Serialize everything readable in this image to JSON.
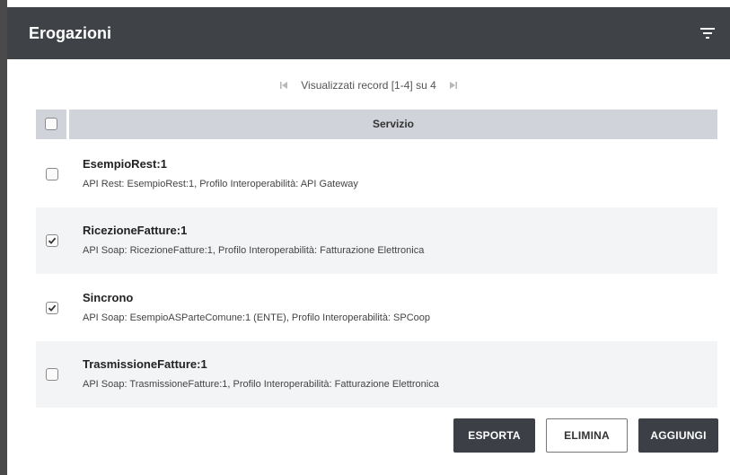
{
  "header": {
    "title": "Erogazioni",
    "filter_icon": "filter-icon"
  },
  "pager": {
    "text": "Visualizzati record [1-4] su 4",
    "first_icon": "first-page-icon",
    "last_icon": "last-page-icon"
  },
  "table": {
    "column_header": "Servizio",
    "select_all_checked": false,
    "rows": [
      {
        "title": "EsempioRest:1",
        "description": "API Rest: EsempioRest:1, Profilo Interoperabilità: API Gateway",
        "checked": false
      },
      {
        "title": "RicezioneFatture:1",
        "description": "API Soap: RicezioneFatture:1, Profilo Interoperabilità: Fatturazione Elettronica",
        "checked": true
      },
      {
        "title": "Sincrono",
        "description": "API Soap: EsempioASParteComune:1 (ENTE), Profilo Interoperabilità: SPCoop",
        "checked": true
      },
      {
        "title": "TrasmissioneFatture:1",
        "description": "API Soap: TrasmissioneFatture:1, Profilo Interoperabilità: Fatturazione Elettronica",
        "checked": false
      }
    ]
  },
  "actions": {
    "export_label": "ESPORTA",
    "delete_label": "ELIMINA",
    "add_label": "AGGIUNGI"
  },
  "colors": {
    "header_bg": "#3f4347",
    "table_header_bg": "#d0d3d9",
    "row_alt_bg": "#f3f4f6",
    "button_dark": "#3c4046"
  }
}
